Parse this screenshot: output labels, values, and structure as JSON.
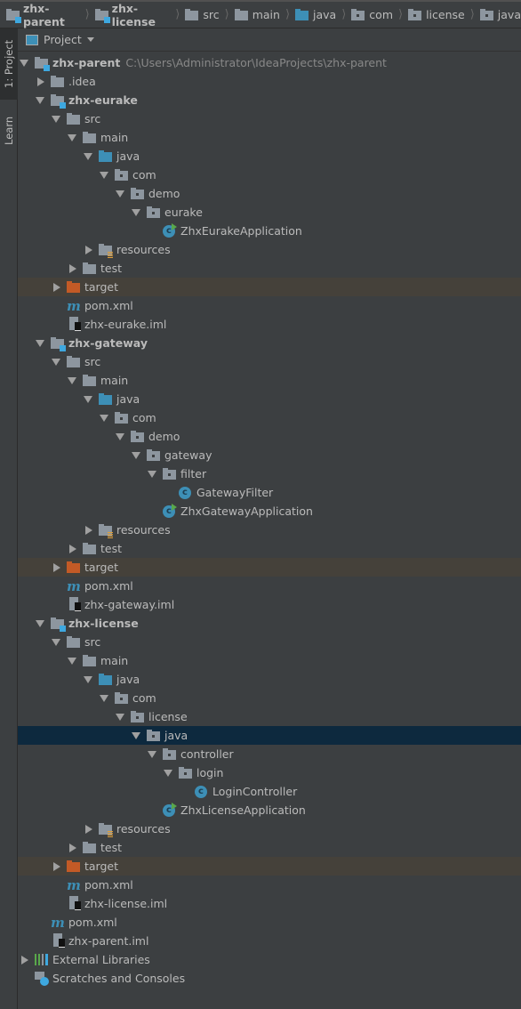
{
  "breadcrumbs": [
    {
      "label": "zhx-parent",
      "icon": "module-folder-icon",
      "bold": true
    },
    {
      "label": "zhx-license",
      "icon": "module-folder-icon",
      "bold": true
    },
    {
      "label": "src",
      "icon": "folder-icon"
    },
    {
      "label": "main",
      "icon": "folder-icon"
    },
    {
      "label": "java",
      "icon": "source-folder-icon"
    },
    {
      "label": "com",
      "icon": "package-icon"
    },
    {
      "label": "license",
      "icon": "package-icon"
    },
    {
      "label": "java",
      "icon": "package-icon"
    }
  ],
  "sidebar": {
    "project_tab": "1: Project",
    "learn_tab": "Learn"
  },
  "panel": {
    "title": "Project"
  },
  "tree": [
    {
      "l": 0,
      "a": "o",
      "i": "mod",
      "t": "zhx-parent",
      "b": true,
      "path": "C:\\Users\\Administrator\\IdeaProjects\\zhx-parent"
    },
    {
      "l": 1,
      "a": "c",
      "i": "folder",
      "t": ".idea"
    },
    {
      "l": 1,
      "a": "o",
      "i": "mod",
      "t": "zhx-eurake",
      "b": true
    },
    {
      "l": 2,
      "a": "o",
      "i": "folder",
      "t": "src"
    },
    {
      "l": 3,
      "a": "o",
      "i": "folder",
      "t": "main"
    },
    {
      "l": 4,
      "a": "o",
      "i": "src",
      "t": "java"
    },
    {
      "l": 5,
      "a": "o",
      "i": "pkg",
      "t": "com"
    },
    {
      "l": 6,
      "a": "o",
      "i": "pkg",
      "t": "demo"
    },
    {
      "l": 7,
      "a": "o",
      "i": "pkg",
      "t": "eurake"
    },
    {
      "l": 8,
      "a": "",
      "i": "app",
      "t": "ZhxEurakeApplication"
    },
    {
      "l": 4,
      "a": "c",
      "i": "res",
      "t": "resources"
    },
    {
      "l": 3,
      "a": "c",
      "i": "folder",
      "t": "test"
    },
    {
      "l": 2,
      "a": "c",
      "i": "tgt",
      "t": "target",
      "hl": "excluded"
    },
    {
      "l": 2,
      "a": "",
      "i": "mvn",
      "t": "pom.xml"
    },
    {
      "l": 2,
      "a": "",
      "i": "iml",
      "t": "zhx-eurake.iml"
    },
    {
      "l": 1,
      "a": "o",
      "i": "mod",
      "t": "zhx-gateway",
      "b": true
    },
    {
      "l": 2,
      "a": "o",
      "i": "folder",
      "t": "src"
    },
    {
      "l": 3,
      "a": "o",
      "i": "folder",
      "t": "main"
    },
    {
      "l": 4,
      "a": "o",
      "i": "src",
      "t": "java"
    },
    {
      "l": 5,
      "a": "o",
      "i": "pkg",
      "t": "com"
    },
    {
      "l": 6,
      "a": "o",
      "i": "pkg",
      "t": "demo"
    },
    {
      "l": 7,
      "a": "o",
      "i": "pkg",
      "t": "gateway"
    },
    {
      "l": 8,
      "a": "o",
      "i": "pkg",
      "t": "filter"
    },
    {
      "l": 9,
      "a": "",
      "i": "cls",
      "t": "GatewayFilter"
    },
    {
      "l": 8,
      "a": "",
      "i": "app",
      "t": "ZhxGatewayApplication"
    },
    {
      "l": 4,
      "a": "c",
      "i": "res",
      "t": "resources"
    },
    {
      "l": 3,
      "a": "c",
      "i": "folder",
      "t": "test"
    },
    {
      "l": 2,
      "a": "c",
      "i": "tgt",
      "t": "target",
      "hl": "excluded"
    },
    {
      "l": 2,
      "a": "",
      "i": "mvn",
      "t": "pom.xml"
    },
    {
      "l": 2,
      "a": "",
      "i": "iml",
      "t": "zhx-gateway.iml"
    },
    {
      "l": 1,
      "a": "o",
      "i": "mod",
      "t": "zhx-license",
      "b": true
    },
    {
      "l": 2,
      "a": "o",
      "i": "folder",
      "t": "src"
    },
    {
      "l": 3,
      "a": "o",
      "i": "folder",
      "t": "main"
    },
    {
      "l": 4,
      "a": "o",
      "i": "src",
      "t": "java"
    },
    {
      "l": 5,
      "a": "o",
      "i": "pkg",
      "t": "com"
    },
    {
      "l": 6,
      "a": "o",
      "i": "pkg",
      "t": "license"
    },
    {
      "l": 7,
      "a": "o",
      "i": "pkg",
      "t": "java",
      "hl": "selected"
    },
    {
      "l": 8,
      "a": "o",
      "i": "pkg",
      "t": "controller"
    },
    {
      "l": 9,
      "a": "o",
      "i": "pkg",
      "t": "login"
    },
    {
      "l": 10,
      "a": "",
      "i": "cls",
      "t": "LoginController"
    },
    {
      "l": 8,
      "a": "",
      "i": "app",
      "t": "ZhxLicenseApplication"
    },
    {
      "l": 4,
      "a": "c",
      "i": "res",
      "t": "resources"
    },
    {
      "l": 3,
      "a": "c",
      "i": "folder",
      "t": "test"
    },
    {
      "l": 2,
      "a": "c",
      "i": "tgt",
      "t": "target",
      "hl": "excluded"
    },
    {
      "l": 2,
      "a": "",
      "i": "mvn",
      "t": "pom.xml"
    },
    {
      "l": 2,
      "a": "",
      "i": "iml",
      "t": "zhx-license.iml"
    },
    {
      "l": 1,
      "a": "",
      "i": "mvn",
      "t": "pom.xml"
    },
    {
      "l": 1,
      "a": "",
      "i": "iml",
      "t": "zhx-parent.iml"
    },
    {
      "l": 0,
      "a": "c",
      "i": "lib",
      "t": "External Libraries"
    },
    {
      "l": 0,
      "a": "",
      "i": "scr",
      "t": "Scratches and Consoles"
    }
  ],
  "colors": {
    "background": "#3c3f41",
    "selection": "#0d293e",
    "excluded_row": "#45413a",
    "accent": "#3d8fb6"
  }
}
